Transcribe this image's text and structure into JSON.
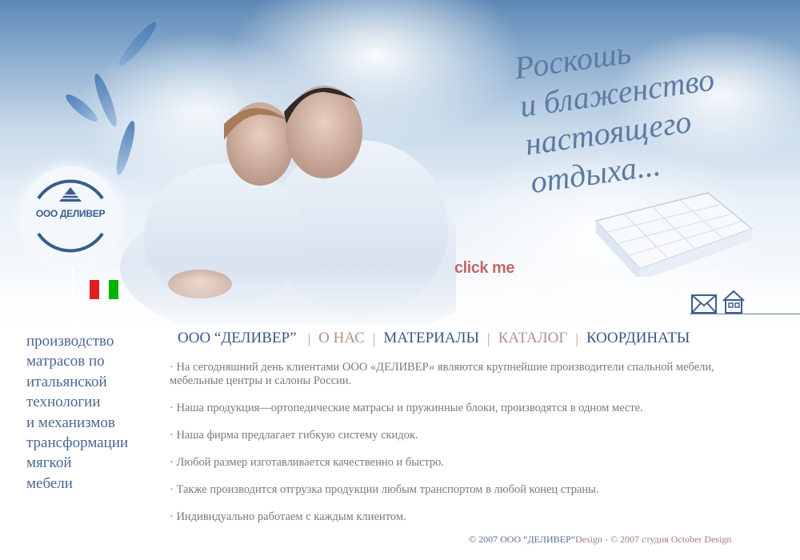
{
  "tagline": {
    "lines": [
      "Роскошь",
      "и блаженство",
      "настоящего",
      "отдыха..."
    ]
  },
  "logo": {
    "text": "ООО ДЕЛИВЕР"
  },
  "click_me": "click me",
  "left_panel": {
    "lines": [
      "производство",
      "матрасов по",
      "итальянской",
      "технологии",
      "и механизмов",
      "трансформации",
      "мягкой",
      "мебели"
    ]
  },
  "nav": {
    "items": [
      {
        "label": "ООО “ДЕЛИВЕР”"
      },
      {
        "label": "О НАС"
      },
      {
        "label": "МАТЕРИАЛЫ"
      },
      {
        "label": "КАТАЛОГ"
      },
      {
        "label": "КООРДИНАТЫ"
      }
    ],
    "separator": "|"
  },
  "content": {
    "paragraphs": [
      "· На сегодняшний день клиентами ООО «ДЕЛИВЕР» являются крупнейшие производители спальной мебели, мебельные центры и салоны России.",
      "· Наша продукция—ортопедические матрасы и пружинные блоки, производятся в одном месте.",
      "· Наша фирма предлагает гибкую систему скидок.",
      "· Любой размер изготавливается качественно и быстро.",
      "· Также производится отгрузка продукции любым транспортом в любой конец страны.",
      "· Индивидуально работаем с каждым клиентом."
    ]
  },
  "footer": {
    "part1": "© 2007 ООО “ДЕЛИВЕР”",
    "part2": "Design - ",
    "part3": "© 2007 студия October Design"
  },
  "colors": {
    "accent_blue": "#3b5785",
    "tagline": "#5e7aa3",
    "click_me": "#c06a6a",
    "flag_green": "#00b400",
    "flag_red": "#e02020"
  },
  "icons": [
    "mail-icon",
    "home-icon",
    "logo-triangle-icon"
  ]
}
